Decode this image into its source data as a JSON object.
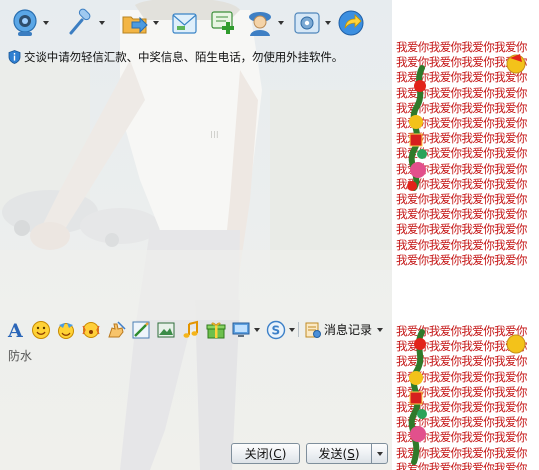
{
  "top_toolbar": {
    "buttons": [
      {
        "name": "video-call",
        "icon": "webcam-icon",
        "has_menu": true
      },
      {
        "name": "voice-call",
        "icon": "microphone-icon",
        "has_menu": true
      },
      {
        "name": "send-file",
        "icon": "folder-transfer-icon",
        "has_menu": true
      },
      {
        "name": "send-email",
        "icon": "email-icon",
        "has_menu": false
      },
      {
        "name": "create-group",
        "icon": "add-chat-icon",
        "has_menu": false
      },
      {
        "name": "remote-assist",
        "icon": "user-assist-icon",
        "has_menu": true
      },
      {
        "name": "apps",
        "icon": "apps-icon",
        "has_menu": true
      },
      {
        "name": "share",
        "icon": "share-arrow-icon",
        "has_menu": false
      }
    ]
  },
  "warning": {
    "text": "交谈中请勿轻信汇款、中奖信息、陌生电话，勿使用外挂软件。",
    "icon": "shield-info-icon"
  },
  "input_toolbar": {
    "tools": [
      {
        "name": "font",
        "icon": "font-a-icon"
      },
      {
        "name": "emoji",
        "icon": "smiley-icon"
      },
      {
        "name": "magic-emoji",
        "icon": "magic-face-icon"
      },
      {
        "name": "shake",
        "icon": "shake-face-icon"
      },
      {
        "name": "gesture",
        "icon": "hand-write-icon"
      },
      {
        "name": "screenshot",
        "icon": "scissors-pencil-icon"
      },
      {
        "name": "send-image",
        "icon": "image-icon"
      },
      {
        "name": "music",
        "icon": "music-note-icon"
      },
      {
        "name": "gift",
        "icon": "gift-icon"
      },
      {
        "name": "screen-share",
        "icon": "monitor-icon"
      },
      {
        "name": "more",
        "icon": "circle-s-icon"
      }
    ],
    "message_log_label": "消息记录",
    "message_log_icon": "message-log-icon"
  },
  "input": {
    "value": "防水"
  },
  "buttons": {
    "close_label": "关闭(",
    "close_key": "C",
    "close_suffix": ")",
    "send_label": "发送(",
    "send_key": "S",
    "send_suffix": ")"
  },
  "side_pattern": {
    "line": "我爱你我爱你我爱你我爱你"
  },
  "colors": {
    "pattern_red": "#c41414",
    "window_bg": "#f2f2ef",
    "button_border": "#7f8f9c"
  }
}
